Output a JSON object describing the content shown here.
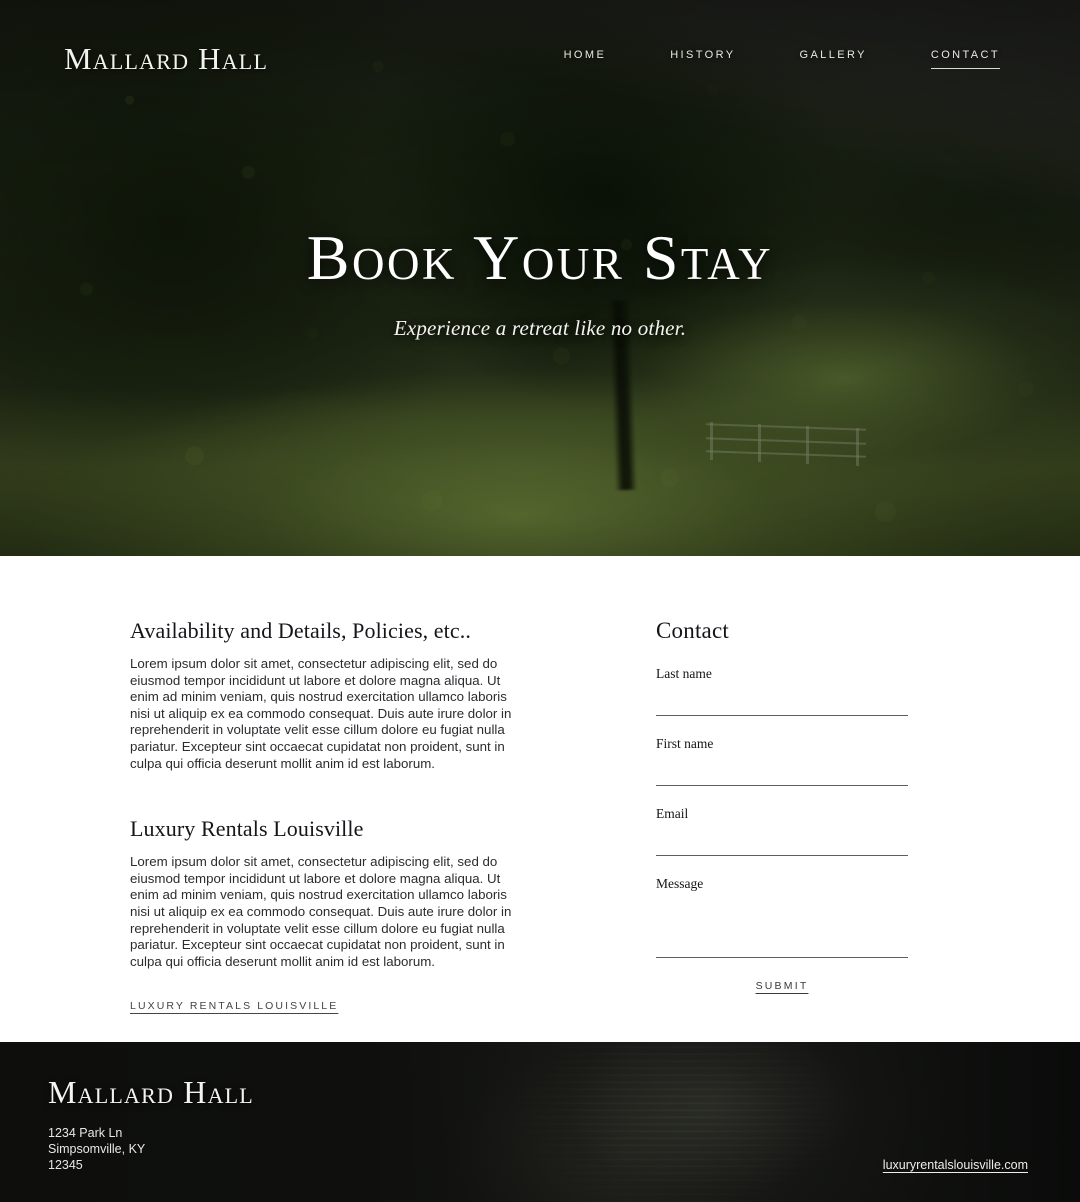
{
  "brand": {
    "name": "Mallard Hall"
  },
  "nav": {
    "items": [
      {
        "label": "HOME",
        "active": false
      },
      {
        "label": "HISTORY",
        "active": false
      },
      {
        "label": "GALLERY",
        "active": false
      },
      {
        "label": "CONTACT",
        "active": true
      }
    ]
  },
  "hero": {
    "title": "Book Your Stay",
    "subtitle": "Experience a retreat like no other."
  },
  "main": {
    "sections": [
      {
        "heading": "Availability and Details, Policies, etc..",
        "body": "Lorem ipsum dolor sit amet, consectetur adipiscing elit, sed do eiusmod tempor incididunt ut labore et dolore magna aliqua. Ut enim ad minim veniam, quis nostrud exercitation ullamco laboris nisi ut aliquip ex ea commodo consequat. Duis aute irure dolor in reprehenderit in voluptate velit esse cillum dolore eu fugiat nulla pariatur. Excepteur sint occaecat cupidatat non proident, sunt in culpa qui officia deserunt mollit anim id est laborum."
      },
      {
        "heading": "Luxury Rentals Louisville",
        "body": "Lorem ipsum dolor sit amet, consectetur adipiscing elit, sed do eiusmod tempor incididunt ut labore et dolore magna aliqua. Ut enim ad minim veniam, quis nostrud exercitation ullamco laboris nisi ut aliquip ex ea commodo consequat. Duis aute irure dolor in reprehenderit in voluptate velit esse cillum dolore eu fugiat nulla pariatur. Excepteur sint occaecat cupidatat non proident, sunt in culpa qui officia deserunt mollit anim id est laborum."
      }
    ],
    "link_label": "LUXURY RENTALS LOUISVILLE"
  },
  "form": {
    "title": "Contact",
    "fields": [
      {
        "label": "Last name",
        "value": "",
        "placeholder": ""
      },
      {
        "label": "First name",
        "value": "",
        "placeholder": ""
      },
      {
        "label": "Email",
        "value": "",
        "placeholder": ""
      },
      {
        "label": "Message",
        "value": "",
        "placeholder": ""
      }
    ],
    "submit_label": "SUBMIT"
  },
  "footer": {
    "brand": "Mallard Hall",
    "address_line1": "1234 Park Ln",
    "address_line2": "Simpsomville, KY",
    "address_line3": "12345",
    "website": "luxuryrentalslouisville.com"
  },
  "colors": {
    "hero_overlay": "#1d2516",
    "footer_bg": "#0d0e0d",
    "text_dark": "#16161a",
    "text_light": "#f2f2ee",
    "rule": "#5e5e62"
  }
}
